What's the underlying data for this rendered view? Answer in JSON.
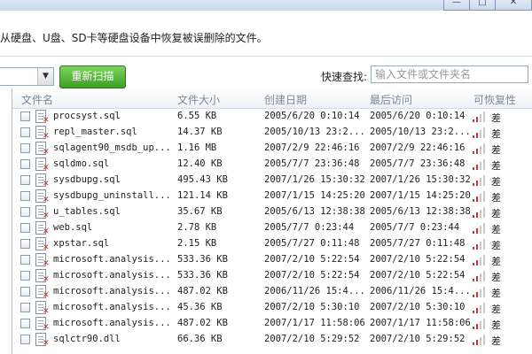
{
  "window": {
    "min_icon": "minimize-icon",
    "max_icon": "maximize-icon",
    "close_icon": "close-icon"
  },
  "description": "从硬盘、U盘、SD卡等硬盘设备中恢复被误删除的文件。",
  "toolbar": {
    "rescan_label": "重新扫描",
    "search_label": "快速查找:",
    "search_placeholder": "输入文件或文件夹名"
  },
  "columns": {
    "name": "文件名",
    "size": "文件大小",
    "created": "创建日期",
    "accessed": "最后访问",
    "recoverability": "可恢复性"
  },
  "files": [
    {
      "name": "procsyst.sql",
      "size": "6.55 KB",
      "created": "2005/6/20 0:10:14",
      "accessed": "2005/6/20 0:10:14",
      "rating": "差"
    },
    {
      "name": "repl_master.sql",
      "size": "14.37 KB",
      "created": "2005/10/13 23:2...",
      "accessed": "2005/10/13 23:2...",
      "rating": "差"
    },
    {
      "name": "sqlagent90_msdb_up...",
      "size": "1.16 MB",
      "created": "2007/2/9 22:46:16",
      "accessed": "2007/2/9 22:46:16",
      "rating": "差"
    },
    {
      "name": "sqldmo.sql",
      "size": "12.40 KB",
      "created": "2005/7/7 23:36:48",
      "accessed": "2005/7/7 23:36:48",
      "rating": "差"
    },
    {
      "name": "sysdbupg.sql",
      "size": "495.43 KB",
      "created": "2007/1/26 15:30:32",
      "accessed": "2007/1/26 15:30:32",
      "rating": "差"
    },
    {
      "name": "sysdbupg_uninstall...",
      "size": "121.14 KB",
      "created": "2007/1/15 14:25:20",
      "accessed": "2007/1/15 14:25:20",
      "rating": "差"
    },
    {
      "name": "u_tables.sql",
      "size": "35.67 KB",
      "created": "2005/6/13 12:38:38",
      "accessed": "2005/6/13 12:38:38",
      "rating": "差"
    },
    {
      "name": "web.sql",
      "size": "2.78 KB",
      "created": "2005/7/7 0:23:44",
      "accessed": "2005/7/7 0:23:44",
      "rating": "差"
    },
    {
      "name": "xpstar.sql",
      "size": "2.15 KB",
      "created": "2005/7/27 0:11:48",
      "accessed": "2005/7/27 0:11:48",
      "rating": "差"
    },
    {
      "name": "microsoft.analysis...",
      "size": "533.36 KB",
      "created": "2007/2/10 5:22:54",
      "accessed": "2007/2/10 5:22:54",
      "rating": "差"
    },
    {
      "name": "microsoft.analysis...",
      "size": "533.36 KB",
      "created": "2007/2/10 5:22:54",
      "accessed": "2007/2/10 5:22:54",
      "rating": "差"
    },
    {
      "name": "microsoft.analysis...",
      "size": "487.02 KB",
      "created": "2006/11/26 15:4...",
      "accessed": "2006/11/26 15:4...",
      "rating": "差"
    },
    {
      "name": "microsoft.analysis...",
      "size": "45.36 KB",
      "created": "2007/2/10 5:30:10",
      "accessed": "2007/2/10 5:30:10",
      "rating": "差"
    },
    {
      "name": "microsoft.analysis...",
      "size": "487.02 KB",
      "created": "2007/1/17 11:58:06",
      "accessed": "2007/1/17 11:58:06",
      "rating": "差"
    },
    {
      "name": "sqlctr90.dll",
      "size": "66.36 KB",
      "created": "2007/2/10 5:29:52",
      "accessed": "2007/2/10 5:29:52",
      "rating": "差"
    }
  ]
}
